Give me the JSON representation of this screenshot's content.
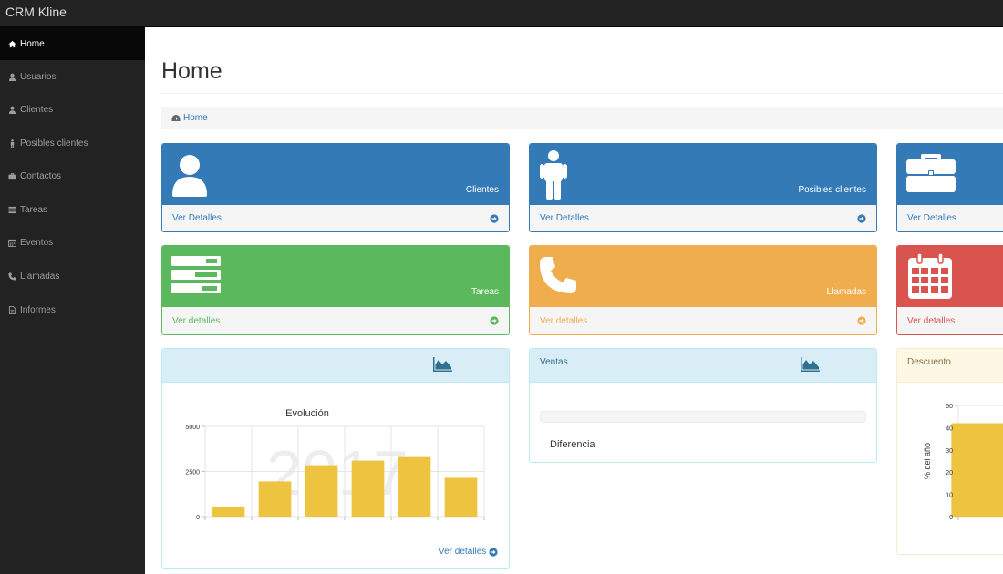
{
  "app": {
    "title": "CRM Kline"
  },
  "sidebar": {
    "items": [
      {
        "label": "Home",
        "icon": "home-icon",
        "active": true
      },
      {
        "label": "Usuarios",
        "icon": "user-icon",
        "active": false
      },
      {
        "label": "Clientes",
        "icon": "user-icon",
        "active": false
      },
      {
        "label": "Posibles clientes",
        "icon": "male-icon",
        "active": false
      },
      {
        "label": "Contactos",
        "icon": "briefcase-icon",
        "active": false
      },
      {
        "label": "Tareas",
        "icon": "tasks-icon",
        "active": false
      },
      {
        "label": "Eventos",
        "icon": "calendar-icon",
        "active": false
      },
      {
        "label": "Llamadas",
        "icon": "phone-icon",
        "active": false
      },
      {
        "label": "Informes",
        "icon": "file-icon",
        "active": false
      }
    ]
  },
  "page": {
    "title": "Home"
  },
  "breadcrumb": {
    "label": "Home",
    "icon": "dashboard-icon"
  },
  "panels": [
    {
      "label": "Clientes",
      "link": "Ver Detalles",
      "color": "#337ab7",
      "icon": "user-icon"
    },
    {
      "label": "Posibles clientes",
      "link": "Ver Detalles",
      "color": "#337ab7",
      "icon": "male-icon"
    },
    {
      "label": "",
      "link": "Ver Detalles",
      "color": "#337ab7",
      "icon": "briefcase-icon"
    },
    {
      "label": "Tareas",
      "link": "Ver detalles",
      "color": "#5cb85c",
      "icon": "tasks-icon"
    },
    {
      "label": "Llamadas",
      "link": "Ver detalles",
      "color": "#f0ad4e",
      "icon": "phone-icon"
    },
    {
      "label": "",
      "link": "Ver detalles",
      "color": "#d9534f",
      "icon": "calendar-icon"
    }
  ],
  "ventas": {
    "title": "Ventas",
    "diff_label": "Diferencia"
  },
  "descuento": {
    "title": "Descuento"
  },
  "evolucion": {
    "more_link": "Ver detalles"
  },
  "chart_data": [
    {
      "type": "bar",
      "title": "Evolución",
      "watermark": "2017",
      "categories": [
        "",
        "",
        "",
        "",
        "",
        ""
      ],
      "values": [
        550,
        1950,
        2850,
        3100,
        3300,
        2150
      ],
      "ylim": [
        0,
        5000
      ],
      "yticks": [
        "0",
        "2500",
        "5000"
      ],
      "grid": true,
      "color": "#eec33f"
    },
    {
      "type": "bar",
      "categories": [
        ""
      ],
      "values": [
        42
      ],
      "ylabel": "% del año",
      "ylim": [
        0,
        50
      ],
      "yticks": [
        "0",
        "10",
        "20",
        "30",
        "40",
        "50"
      ],
      "grid": true,
      "color": "#eec33f"
    }
  ]
}
